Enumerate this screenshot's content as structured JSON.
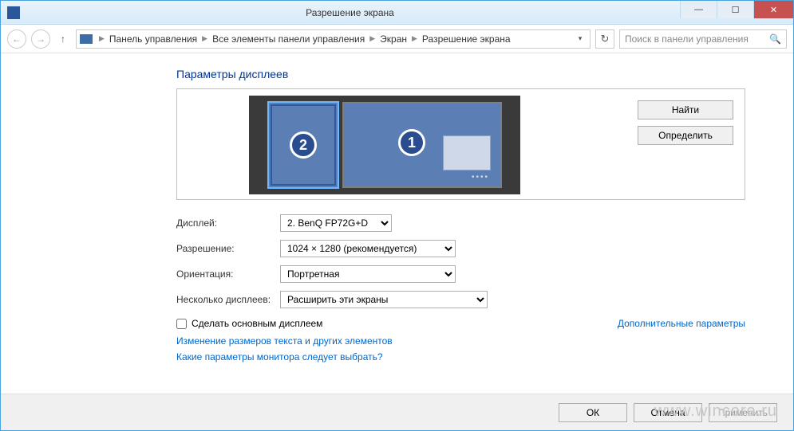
{
  "titlebar": {
    "title": "Разрешение экрана"
  },
  "breadcrumb": {
    "items": [
      "Панель управления",
      "Все элементы панели управления",
      "Экран",
      "Разрешение экрана"
    ]
  },
  "search": {
    "placeholder": "Поиск в панели управления"
  },
  "heading": "Параметры дисплеев",
  "monitors": {
    "one": "1",
    "two": "2"
  },
  "buttons": {
    "find": "Найти",
    "detect": "Определить",
    "ok": "ОК",
    "cancel": "Отмена",
    "apply": "Применить"
  },
  "labels": {
    "display": "Дисплей:",
    "resolution": "Разрешение:",
    "orientation": "Ориентация:",
    "multiple": "Несколько дисплеев:",
    "make_primary": "Сделать основным дисплеем",
    "advanced": "Дополнительные параметры"
  },
  "values": {
    "display": "2. BenQ FP72G+D",
    "resolution": "1024 × 1280 (рекомендуется)",
    "orientation": "Портретная",
    "multiple": "Расширить эти экраны"
  },
  "links": {
    "text_size": "Изменение размеров текста и других элементов",
    "which_params": "Какие параметры монитора следует выбрать?"
  },
  "watermark": "www.wincore.ru"
}
